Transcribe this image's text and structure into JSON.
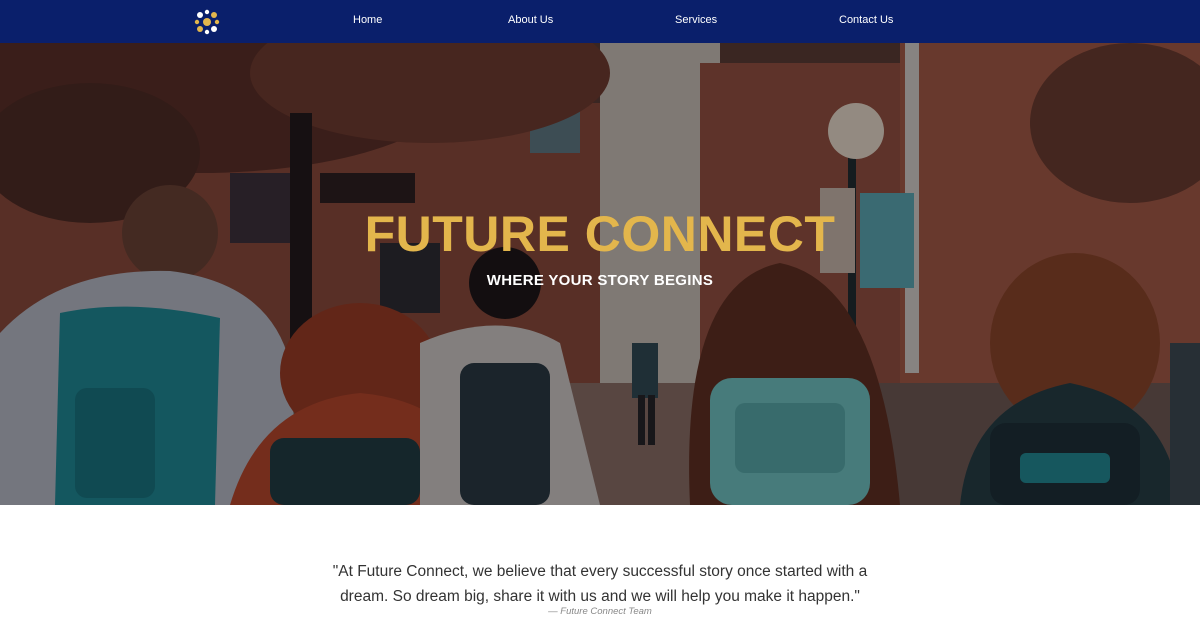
{
  "nav": {
    "logo": "logo-icon",
    "items": [
      {
        "label": "Home"
      },
      {
        "label": "About Us"
      },
      {
        "label": "Services"
      },
      {
        "label": "Contact Us"
      }
    ]
  },
  "hero": {
    "title": "FUTURE CONNECT",
    "subtitle": "WHERE YOUR STORY BEGINS"
  },
  "quote": {
    "text": "\"At Future Connect, we believe that every successful story once started with a dream. So dream big, share it with us and we will help you make it happen.\"",
    "author": "— Future Connect Team"
  },
  "colors": {
    "nav_bg": "#0a1f6b",
    "title_gold": "#e3b64c",
    "text_white": "#ffffff",
    "quote_text": "#333333"
  }
}
